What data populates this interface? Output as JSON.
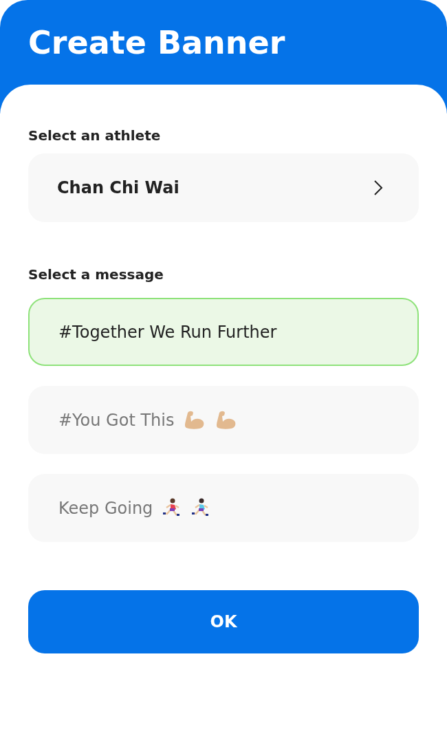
{
  "header": {
    "title": "Create Banner"
  },
  "athlete": {
    "label": "Select an athlete",
    "value": "Chan Chi Wai"
  },
  "message": {
    "label": "Select a message",
    "options": [
      {
        "text": "#Together We Run Further",
        "selected": true
      },
      {
        "text": "#You Got This",
        "selected": false,
        "icons": [
          {
            "kind": "muscle"
          },
          {
            "kind": "muscle"
          }
        ]
      },
      {
        "text": "Keep Going",
        "selected": false,
        "icons": [
          {
            "kind": "runnerman"
          },
          {
            "kind": "runnerwoman"
          }
        ]
      }
    ]
  },
  "button": {
    "label": "OK"
  }
}
